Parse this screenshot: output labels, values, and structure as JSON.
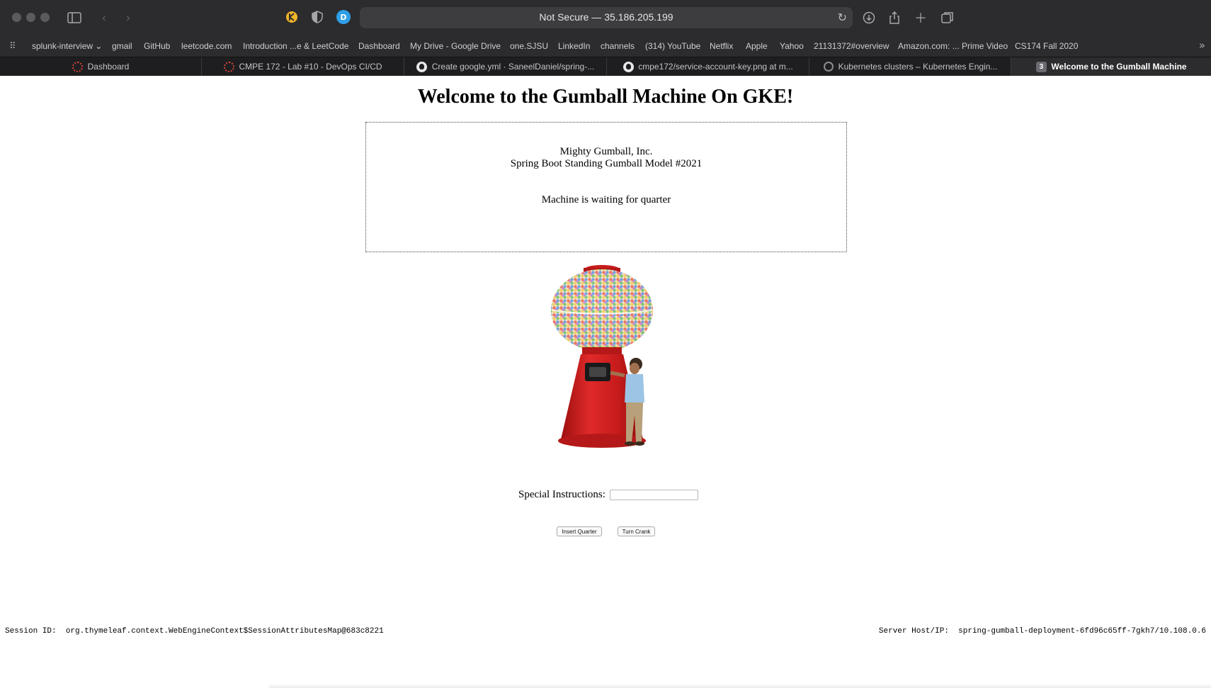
{
  "browser": {
    "url_text": "Not Secure — 35.186.205.199",
    "bookmarks": [
      "splunk-interview",
      "gmail",
      "GitHub",
      "leetcode.com",
      "Introduction ...e & LeetCode",
      "Dashboard",
      "My Drive - Google Drive",
      "one.SJSU",
      "LinkedIn",
      "channels",
      "(314) YouTube",
      "Netflix",
      "Apple",
      "Yahoo",
      "21131372#overview",
      "Amazon.com: ... Prime Video",
      "CS174 Fall 2020"
    ],
    "tabs": [
      {
        "label": "Dashboard",
        "favicon": "circleci-icon"
      },
      {
        "label": "CMPE 172 - Lab #10 - DevOps CI/CD",
        "favicon": "circleci-icon"
      },
      {
        "label": "Create google.yml · SaneelDaniel/spring-...",
        "favicon": "github-icon"
      },
      {
        "label": "cmpe172/service-account-key.png at m...",
        "favicon": "github-icon"
      },
      {
        "label": "Kubernetes clusters – Kubernetes Engin...",
        "favicon": "gear-icon"
      },
      {
        "label": "Welcome to the Gumball Machine",
        "favicon": "number-badge",
        "badge": "3",
        "active": true
      }
    ]
  },
  "page": {
    "title": "Welcome to the Gumball Machine On GKE!",
    "company": "Mighty Gumball, Inc.",
    "model": "Spring Boot Standing Gumball Model #2021",
    "state": "Machine is waiting for quarter",
    "instructions_label": "Special Instructions:",
    "instructions_value": "",
    "insert_button": "Insert Quarter",
    "crank_button": "Turn Crank",
    "session_label": "Session ID:",
    "session_value": "org.thymeleaf.context.WebEngineContext$SessionAttributesMap@683c8221",
    "server_label": "Server Host/IP:",
    "server_value": "spring-gumball-deployment-6fd96c65ff-7gkh7/10.108.0.6"
  },
  "colors": {
    "chrome_bg": "#2c2c2e",
    "tabbar_bg": "#1e1e20",
    "machine_red": "#d21f1f"
  }
}
